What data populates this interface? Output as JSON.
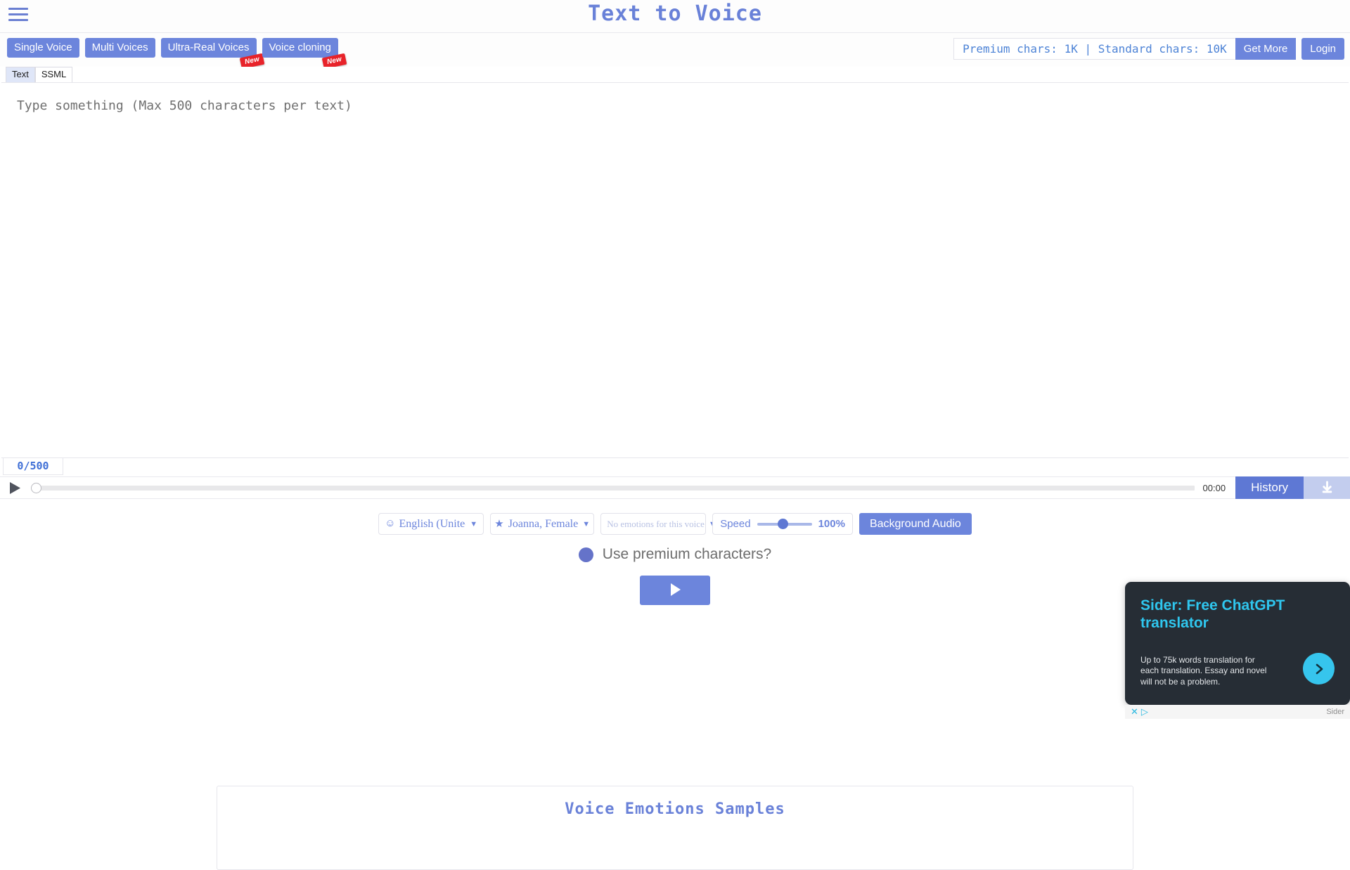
{
  "header": {
    "title": "Text to Voice",
    "menu_icon": "hamburger-menu-icon"
  },
  "toolbar": {
    "modes": [
      {
        "label": "Single Voice",
        "badge": null
      },
      {
        "label": "Multi Voices",
        "badge": null
      },
      {
        "label": "Ultra-Real Voices",
        "badge": "New"
      },
      {
        "label": "Voice cloning",
        "badge": "New"
      }
    ],
    "credits": "Premium chars: 1K | Standard chars: 10K",
    "get_more_label": "Get More",
    "login_label": "Login"
  },
  "sub_tabs": [
    {
      "label": "Text",
      "active": true
    },
    {
      "label": "SSML",
      "active": false
    }
  ],
  "editor": {
    "placeholder": "Type something (Max 500 characters per text)",
    "value": "",
    "counter": "0/500"
  },
  "player": {
    "play_icon": "play-icon",
    "current_time": "00:00",
    "progress_percent": 0,
    "history_label": "History",
    "download_icon": "download-icon"
  },
  "controls": {
    "language": {
      "icon": "smiley-face-icon",
      "value": "English (United States)",
      "display": "English (United St"
    },
    "voice": {
      "icon": "star-icon",
      "value": "Joanna, Female"
    },
    "emotion": {
      "value": "No emotions for this voice"
    },
    "speed": {
      "label": "Speed",
      "value": "100%",
      "percent": 38
    },
    "background_audio_label": "Background Audio"
  },
  "premium": {
    "label": "Use premium characters?",
    "checked": true,
    "color": "#6573c9"
  },
  "generate": {
    "icon": "play-icon"
  },
  "samples": {
    "title": "Voice Emotions Samples"
  },
  "ad": {
    "title": "Sider: Free ChatGPT translator",
    "body": "Up to 75k words translation for each translation. Essay and novel will not be a problem.",
    "arrow_icon": "chevron-right-icon",
    "close_icon": "close-icon",
    "adchoices_icon": "adchoices-icon",
    "brand": "Sider",
    "accent": "#2fc6ee",
    "background": "#262d35"
  },
  "theme": {
    "primary": "#6c85dc",
    "title_color": "#6981d8",
    "badge_red": "#e8232a"
  }
}
